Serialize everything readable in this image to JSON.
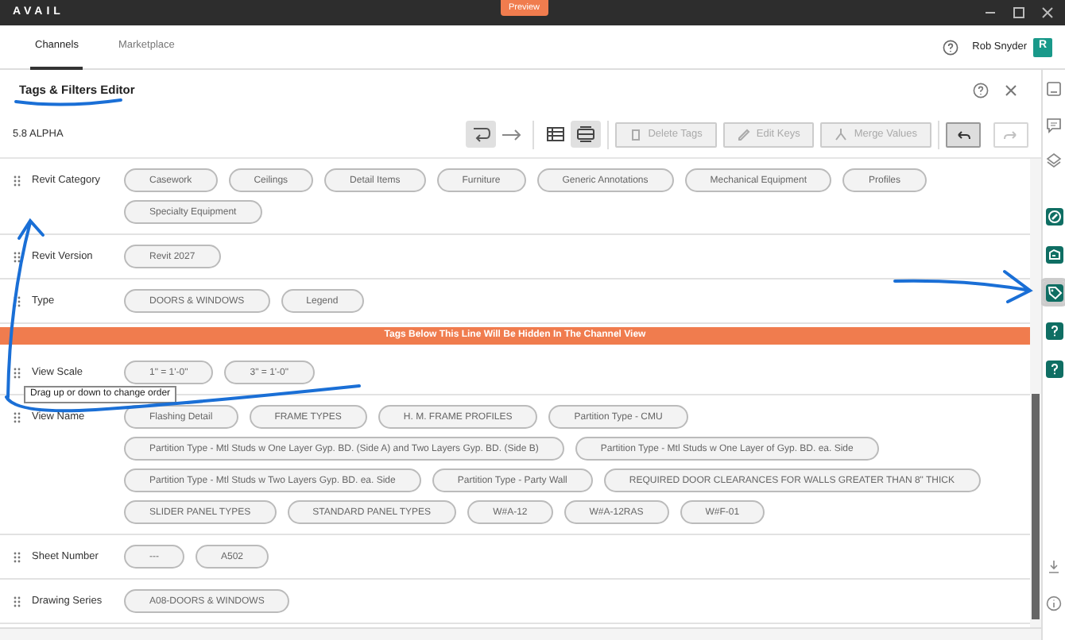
{
  "window": {
    "logo": "AVAIL",
    "badge": "Preview"
  },
  "nav": {
    "tabs": [
      {
        "label": "Channels",
        "selected": true
      },
      {
        "label": "Marketplace",
        "selected": false
      }
    ],
    "user": "Rob Snyder",
    "avatar": "R"
  },
  "panel": {
    "title": "Tags & Filters Editor",
    "version": "5.8 ALPHA"
  },
  "toolbar": {
    "wrap_toggles": [
      {
        "selected": true
      },
      {
        "selected": false
      }
    ],
    "view_toggles": [
      {
        "selected": false
      },
      {
        "selected": true
      }
    ],
    "actions": [
      {
        "label": "Delete Tags",
        "disabled": true
      },
      {
        "label": "Edit Keys",
        "disabled": true
      },
      {
        "label": "Merge Values",
        "disabled": true
      }
    ],
    "history": [
      {
        "selected": true,
        "disabled": false
      },
      {
        "selected": false,
        "disabled": true
      }
    ]
  },
  "rows": [
    {
      "kind": "field",
      "name": "Revit Category",
      "tags": [
        "Casework",
        "Ceilings",
        "Detail Items",
        "Furniture",
        "Generic Annotations",
        "Mechanical Equipment",
        "Profiles",
        "Specialty Equipment"
      ]
    },
    {
      "kind": "field",
      "name": "Revit Version",
      "tags": [
        "Revit 2027"
      ]
    },
    {
      "kind": "field",
      "name": "Type",
      "tags": [
        "DOORS & WINDOWS",
        "Legend"
      ]
    },
    {
      "kind": "banner",
      "text": "Tags Below This Line Will Be Hidden In The Channel View"
    },
    {
      "kind": "field",
      "name": "View Scale",
      "tags": [
        "1\" = 1'-0\"",
        "3\" = 1'-0\""
      ]
    },
    {
      "kind": "field",
      "name": "View Name",
      "tags": [
        "Flashing Detail",
        "FRAME TYPES",
        "H. M. FRAME PROFILES",
        "Partition Type - CMU",
        "Partition Type - Mtl Studs w One Layer Gyp. BD. (Side A) and Two Layers Gyp. BD. (Side B)",
        "Partition Type - Mtl Studs w One Layer of Gyp. BD. ea. Side",
        "Partition Type - Mtl Studs w Two Layers Gyp. BD. ea. Side",
        "Partition Type - Party Wall",
        "REQUIRED DOOR CLEARANCES FOR WALLS GREATER THAN 8\" THICK",
        "SLIDER PANEL TYPES",
        "STANDARD PANEL TYPES",
        "W#A-12",
        "W#A-12RAS",
        "W#F-01"
      ]
    },
    {
      "kind": "field",
      "name": "Sheet Number",
      "tags": [
        "---",
        "A502"
      ]
    },
    {
      "kind": "field",
      "name": "Drawing Series",
      "tags": [
        "A08-DOORS & WINDOWS"
      ]
    }
  ],
  "tooltip": "Drag up or down to change order",
  "sidebar": [
    {
      "selected": false
    },
    {
      "selected": false
    },
    {
      "selected": true
    },
    {
      "selected": false
    },
    {
      "selected": false
    }
  ]
}
